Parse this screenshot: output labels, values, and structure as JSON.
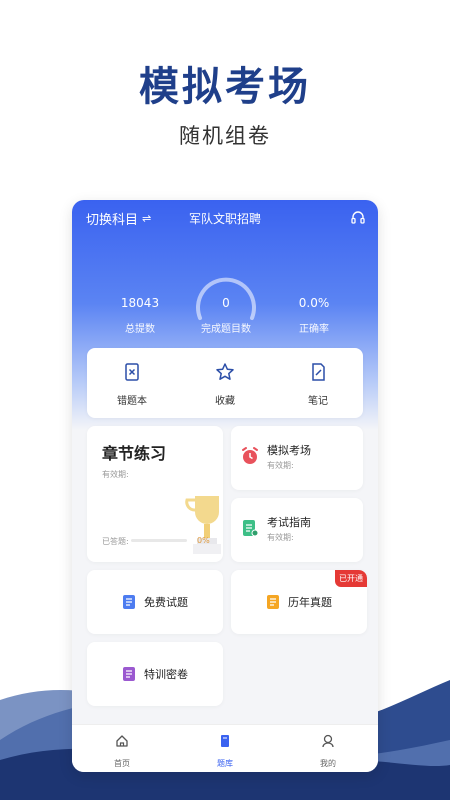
{
  "promo": {
    "title": "模拟考场",
    "subtitle": "随机组卷"
  },
  "header": {
    "switch_label": "切换科目",
    "switch_icon": "⇌",
    "exam_name": "军队文职招聘"
  },
  "stats": [
    {
      "value": "18043",
      "label": "总提数"
    },
    {
      "value": "0",
      "label": "完成题目数"
    },
    {
      "value": "0.0%",
      "label": "正确率"
    }
  ],
  "quick_actions": [
    {
      "label": "错题本",
      "icon": "wrong-book-icon"
    },
    {
      "label": "收藏",
      "icon": "star-icon"
    },
    {
      "label": "笔记",
      "icon": "note-icon"
    }
  ],
  "chapter": {
    "title": "章节练习",
    "valid": "有效期:",
    "progress_label": "已答题:",
    "progress_text": "0%",
    "progress_fraction": 0.0
  },
  "mock_exam": {
    "title": "模拟考场",
    "valid": "有效期:"
  },
  "guide": {
    "title": "考试指南",
    "valid": "有效期:"
  },
  "free_questions": {
    "label": "免费试题"
  },
  "past_papers": {
    "label": "历年真题",
    "badge": "已开通"
  },
  "special_papers": {
    "label": "特训密卷"
  },
  "tabs": [
    {
      "label": "首页",
      "icon": "home-icon"
    },
    {
      "label": "题库",
      "icon": "question-bank-icon"
    },
    {
      "label": "我的",
      "icon": "profile-icon"
    }
  ],
  "colors": {
    "brand": "#1f3f8a",
    "accent": "#3a62f0",
    "badge": "#e53935",
    "progress": "#f0b040"
  }
}
